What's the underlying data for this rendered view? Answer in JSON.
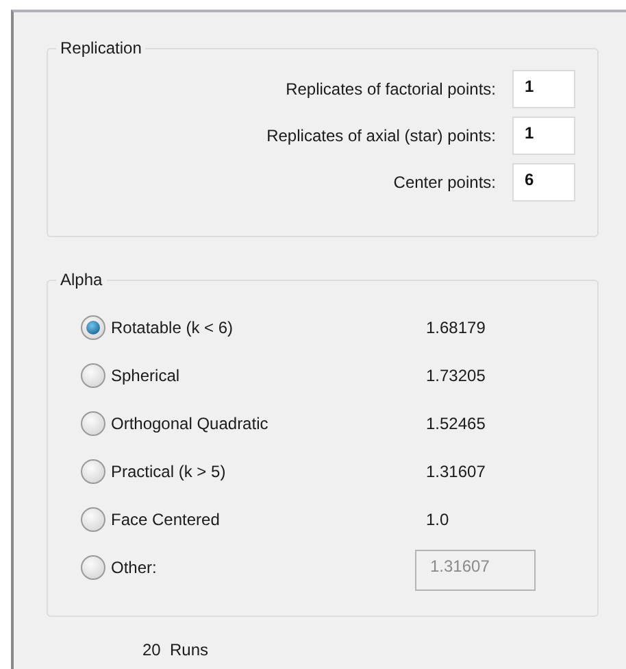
{
  "replication": {
    "title": "Replication",
    "fields": [
      {
        "label": "Replicates of factorial points:",
        "value": "1"
      },
      {
        "label": "Replicates of axial (star) points:",
        "value": "1"
      },
      {
        "label": "Center points:",
        "value": "6"
      }
    ]
  },
  "alpha": {
    "title": "Alpha",
    "options": [
      {
        "label": "Rotatable (k < 6)",
        "selected": true,
        "kind": "value",
        "value": "1.68179"
      },
      {
        "label": "Spherical",
        "selected": false,
        "kind": "value",
        "value": "1.73205"
      },
      {
        "label": "Orthogonal Quadratic",
        "selected": false,
        "kind": "value",
        "value": "1.52465"
      },
      {
        "label": "Practical (k > 5)",
        "selected": false,
        "kind": "value",
        "value": "1.31607"
      },
      {
        "label": "Face Centered",
        "selected": false,
        "kind": "value",
        "value": "1.0"
      },
      {
        "label": "Other:",
        "selected": false,
        "kind": "field",
        "value": "1.31607",
        "disabled": true
      }
    ]
  },
  "runs": "20  Runs"
}
